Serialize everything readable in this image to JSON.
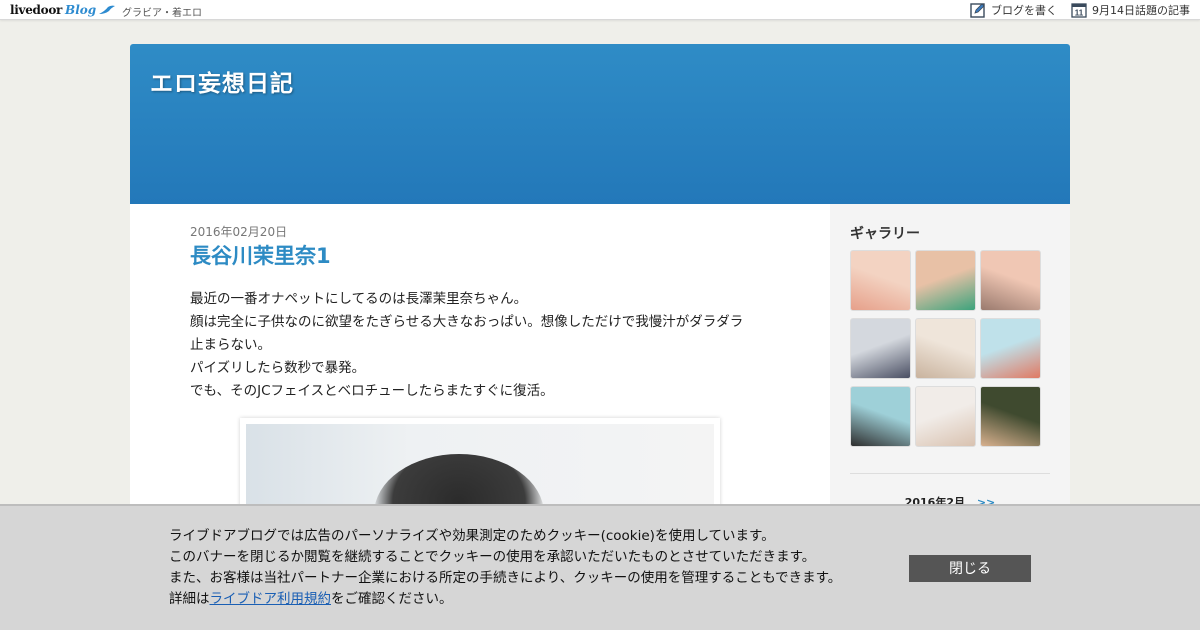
{
  "topbar": {
    "logo_text": "livedoor",
    "logo_blog": "Blog",
    "category": "グラビア・着エロ",
    "write_blog": "ブログを書く",
    "calendar_day": "11",
    "topics": "9月14日話題の記事"
  },
  "header": {
    "blog_title": "エロ妄想日記"
  },
  "post": {
    "date": "2016年02月20日",
    "title": "長谷川茉里奈1",
    "lines": [
      "最近の一番オナペットにしてるのは長澤茉里奈ちゃん。",
      "顔は完全に子供なのに欲望をたぎらせる大きなおっぱい。想像しただけで我慢汁がダラダラ",
      "止まらない。",
      "パイズリしたら数秒で暴発。",
      "でも、そのJCフェイスとベロチューしたらまたすぐに復活。"
    ]
  },
  "sidebar": {
    "gallery_heading": "ギャラリー",
    "thumbs": [
      {
        "color_a": "#f3d3c2",
        "color_b": "#e6a08a"
      },
      {
        "color_a": "#e8c1a6",
        "color_b": "#3ca37c"
      },
      {
        "color_a": "#f0c7b4",
        "color_b": "#9a7a6e"
      },
      {
        "color_a": "#d4d8de",
        "color_b": "#4a4f63"
      },
      {
        "color_a": "#efe5da",
        "color_b": "#c9b39e"
      },
      {
        "color_a": "#bfe1ea",
        "color_b": "#e07a64"
      },
      {
        "color_a": "#9ed0d8",
        "color_b": "#2e2e2e"
      },
      {
        "color_a": "#f1ece8",
        "color_b": "#d9c2b0"
      },
      {
        "color_a": "#3f4a2f",
        "color_b": "#d7b08e"
      }
    ],
    "calendar_month": "2016年2月",
    "calendar_next": ">>"
  },
  "cookie": {
    "line1": "ライブドアブログでは広告のパーソナライズや効果測定のためクッキー(cookie)を使用しています。",
    "line2": "このバナーを閉じるか閲覧を継続することでクッキーの使用を承認いただいたものとさせていただきます。",
    "line3": "また、お客様は当社パートナー企業における所定の手続きにより、クッキーの使用を管理することもできます。",
    "line4_prefix": "詳細は",
    "line4_link": "ライブドア利用規約",
    "line4_suffix": "をご確認ください。",
    "close_label": "閉じる"
  }
}
